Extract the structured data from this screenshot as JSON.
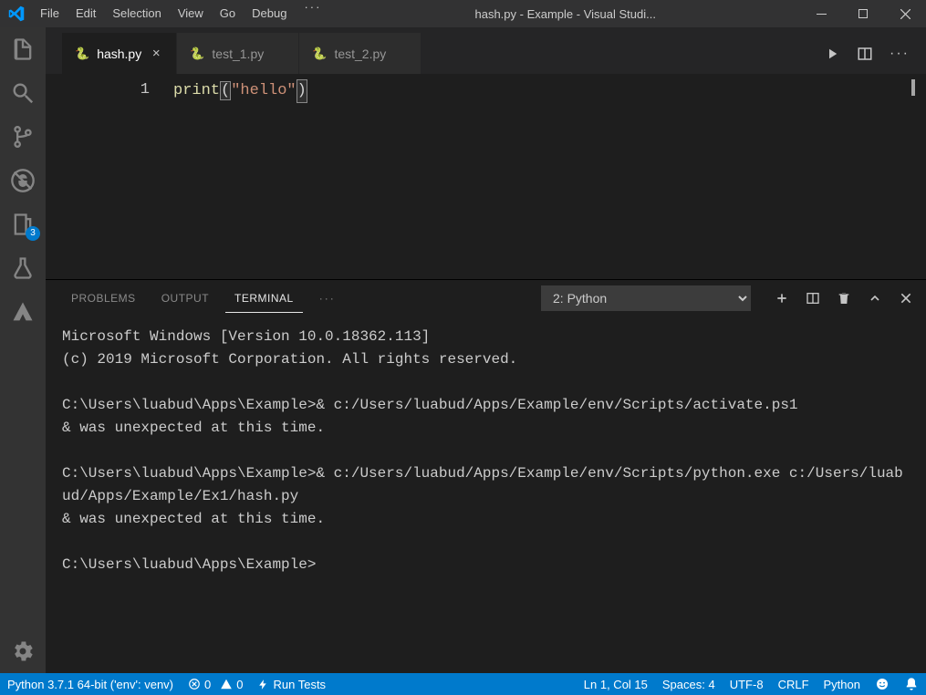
{
  "title": "hash.py - Example - Visual Studi...",
  "menu": [
    "File",
    "Edit",
    "Selection",
    "View",
    "Go",
    "Debug"
  ],
  "tabs": [
    {
      "label": "hash.py",
      "active": true
    },
    {
      "label": "test_1.py",
      "active": false
    },
    {
      "label": "test_2.py",
      "active": false
    }
  ],
  "editor": {
    "lineNumber": "1",
    "fn": "print",
    "str": "\"hello\""
  },
  "panel": {
    "tabs": {
      "problems": "PROBLEMS",
      "output": "OUTPUT",
      "terminal": "TERMINAL"
    },
    "dropdown": "2: Python",
    "terminal": "Microsoft Windows [Version 10.0.18362.113]\n(c) 2019 Microsoft Corporation. All rights reserved.\n\nC:\\Users\\luabud\\Apps\\Example>& c:/Users/luabud/Apps/Example/env/Scripts/activate.ps1\n& was unexpected at this time.\n\nC:\\Users\\luabud\\Apps\\Example>& c:/Users/luabud/Apps/Example/env/Scripts/python.exe c:/Users/luabud/Apps/Example/Ex1/hash.py\n& was unexpected at this time.\n\nC:\\Users\\luabud\\Apps\\Example>"
  },
  "activity": {
    "outlineBadge": "3"
  },
  "status": {
    "python": "Python 3.7.1 64-bit ('env': venv)",
    "errors": "0",
    "warnings": "0",
    "runTests": "Run Tests",
    "ln": "Ln 1, Col 15",
    "spaces": "Spaces: 4",
    "encoding": "UTF-8",
    "eol": "CRLF",
    "lang": "Python"
  }
}
